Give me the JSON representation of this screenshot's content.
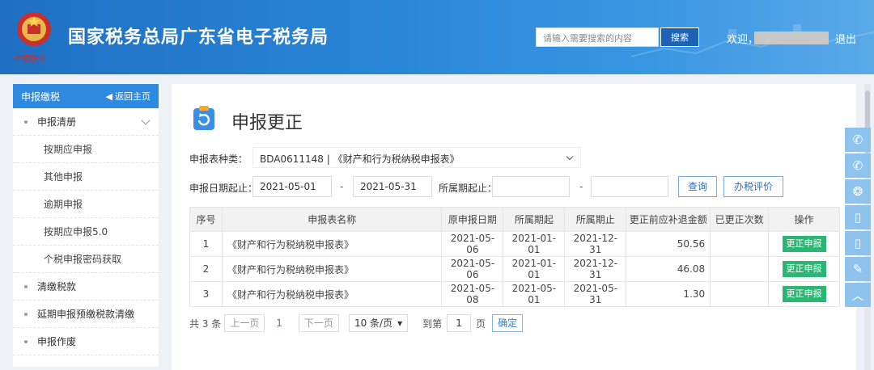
{
  "header": {
    "title": "国家税务总局广东省电子税务局",
    "brand": "中国税务",
    "search_placeholder": "请输入需要搜索的内容",
    "search_button": "搜索",
    "welcome": "欢迎，",
    "logout": "退出"
  },
  "sidebar": {
    "section": "申报缴税",
    "back": "返回主页",
    "items": [
      {
        "label": "申报清册",
        "level": 1
      },
      {
        "label": "按期应申报",
        "level": 2
      },
      {
        "label": "其他申报",
        "level": 2
      },
      {
        "label": "逾期申报",
        "level": 2
      },
      {
        "label": "按期应申报5.0",
        "level": 2
      },
      {
        "label": "个税申报密码获取",
        "level": 2
      },
      {
        "label": "清缴税款",
        "level": 1
      },
      {
        "label": "延期申报预缴税款清缴",
        "level": 1
      },
      {
        "label": "申报作废",
        "level": 1
      }
    ]
  },
  "main": {
    "title": "申报更正",
    "form_type_label": "申报表种类：",
    "form_type_value": "BDA0611148 | 《财产和行为税纳税申报表》",
    "date_label": "申报日期起止：",
    "date_from": "2021-05-01",
    "date_to": "2021-05-31",
    "period_label": "所属期起止：",
    "period_from": "",
    "period_to": "",
    "dash": "-",
    "query_button": "查询",
    "evaluate_button": "办税评价"
  },
  "table": {
    "headers": [
      "序号",
      "申报表名称",
      "原申报日期",
      "所属期起",
      "所属期止",
      "更正前应补退金额",
      "已更正次数",
      "操作"
    ],
    "rows": [
      {
        "no": "1",
        "name": "《财产和行为税纳税申报表》",
        "date": "2021-05-06",
        "start": "2021-01-01",
        "end": "2021-12-31",
        "amount": "50.56",
        "count": "",
        "action": "更正申报"
      },
      {
        "no": "2",
        "name": "《财产和行为税纳税申报表》",
        "date": "2021-05-06",
        "start": "2021-01-01",
        "end": "2021-12-31",
        "amount": "46.08",
        "count": "",
        "action": "更正申报"
      },
      {
        "no": "3",
        "name": "《财产和行为税纳税申报表》",
        "date": "2021-05-08",
        "start": "2021-05-01",
        "end": "2021-05-31",
        "amount": "1.30",
        "count": "",
        "action": "更正申报"
      }
    ]
  },
  "pager": {
    "total": "共 3 条",
    "prev": "上一页",
    "current": "1",
    "next": "下一页",
    "page_size": "10 条/页",
    "goto": "到第",
    "goto_value": "1",
    "page_unit": "页",
    "confirm": "确定"
  },
  "float_icons": [
    "wechat-icon",
    "wechat-icon",
    "weibo-icon",
    "mobile-icon",
    "mobile-icon",
    "edit-icon",
    "back-to-top-icon"
  ],
  "colors": {
    "header_blue": "#2a86d8",
    "sidebar_active": "#2d8ae0",
    "action_green": "#2bb673"
  }
}
